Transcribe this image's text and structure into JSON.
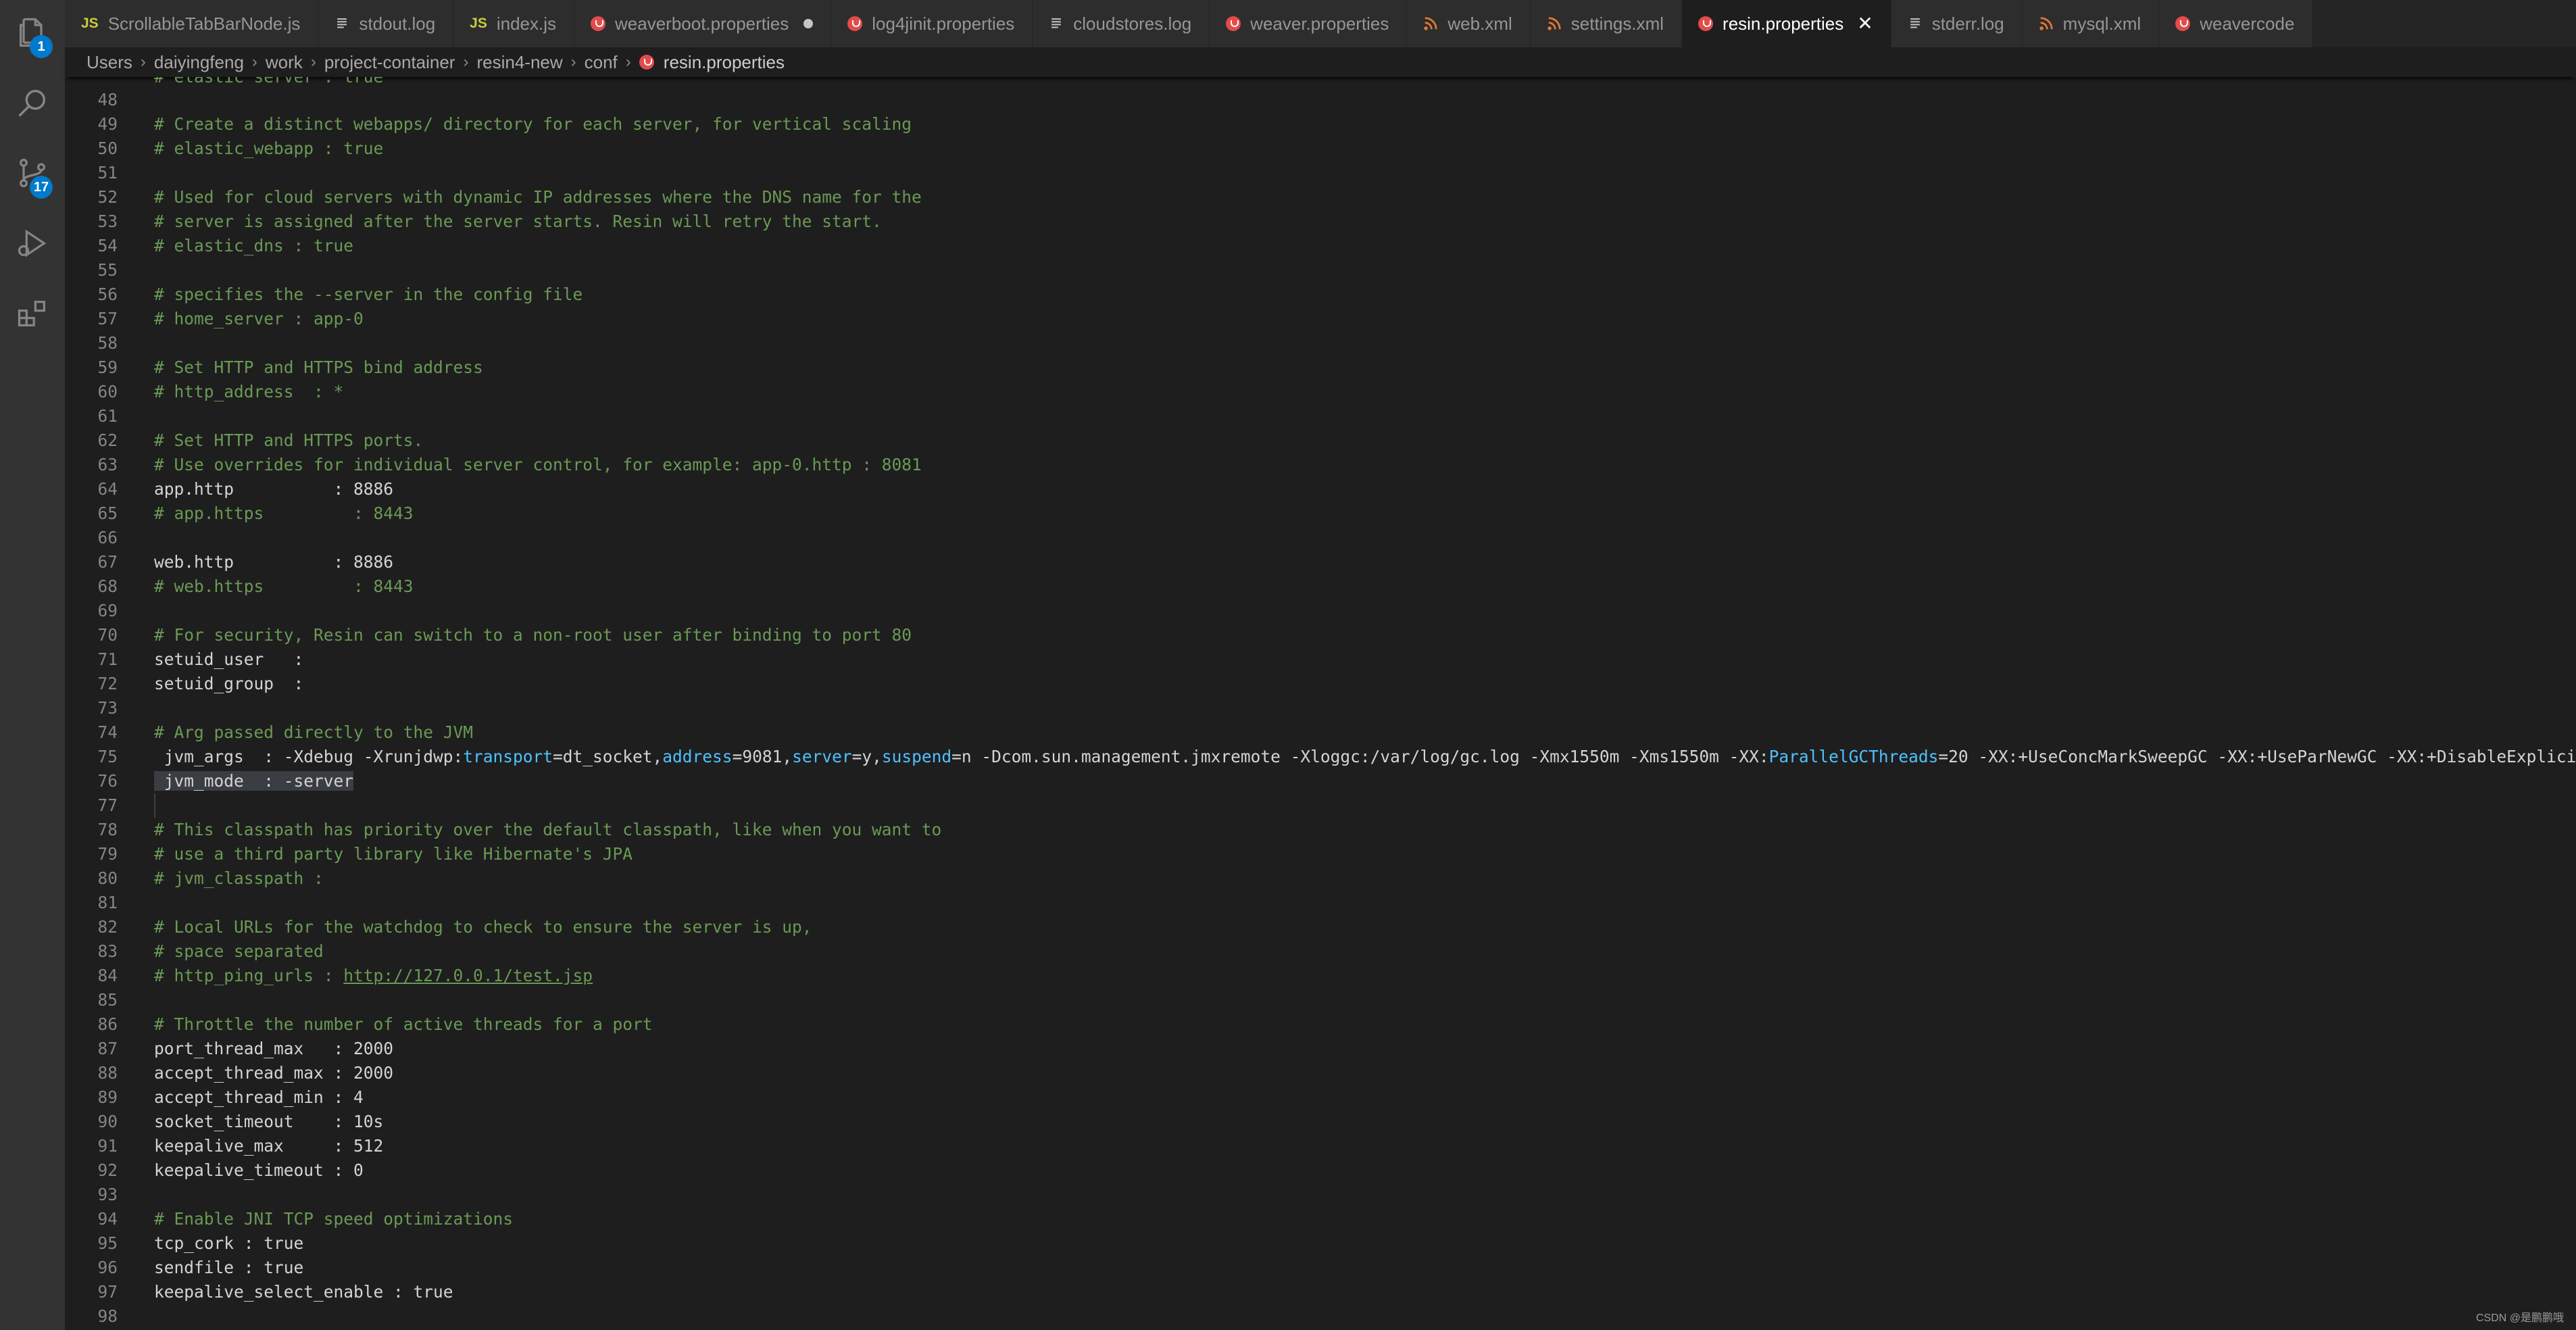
{
  "tabs": [
    {
      "label": "ScrollableTabBarNode.js",
      "icon": "js-file-icon",
      "modified": false,
      "active": false
    },
    {
      "label": "stdout.log",
      "icon": "text-file-icon",
      "modified": false,
      "active": false
    },
    {
      "label": "index.js",
      "icon": "js-file-icon",
      "modified": false,
      "active": false
    },
    {
      "label": "weaverboot.properties",
      "icon": "properties-file-icon",
      "modified": true,
      "active": false
    },
    {
      "label": "log4jinit.properties",
      "icon": "properties-file-icon",
      "modified": false,
      "active": false
    },
    {
      "label": "cloudstores.log",
      "icon": "text-file-icon",
      "modified": false,
      "active": false
    },
    {
      "label": "weaver.properties",
      "icon": "properties-file-icon",
      "modified": false,
      "active": false
    },
    {
      "label": "web.xml",
      "icon": "xml-file-icon",
      "modified": false,
      "active": false
    },
    {
      "label": "settings.xml",
      "icon": "xml-file-icon",
      "modified": false,
      "active": false
    },
    {
      "label": "resin.properties",
      "icon": "properties-file-icon",
      "modified": false,
      "active": true
    },
    {
      "label": "stderr.log",
      "icon": "text-file-icon",
      "modified": false,
      "active": false
    },
    {
      "label": "mysql.xml",
      "icon": "xml-file-icon",
      "modified": false,
      "active": false
    },
    {
      "label": "weavercode",
      "icon": "properties-file-icon",
      "modified": false,
      "active": false
    }
  ],
  "activity_bar": {
    "explorer_badge": "1",
    "scm_badge": "17"
  },
  "breadcrumb": [
    "Users",
    "daiyingfeng",
    "work",
    "project-container",
    "resin4-new",
    "conf"
  ],
  "breadcrumb_file": "resin.properties",
  "editor": {
    "partial_top_line": "# elastic_server : true",
    "lines": [
      {
        "n": "48",
        "t": ""
      },
      {
        "n": "49",
        "t": "# Create a distinct webapps/ directory for each server, for vertical scaling"
      },
      {
        "n": "50",
        "t": "# elastic_webapp : true"
      },
      {
        "n": "51",
        "t": ""
      },
      {
        "n": "52",
        "t": "# Used for cloud servers with dynamic IP addresses where the DNS name for the"
      },
      {
        "n": "53",
        "t": "# server is assigned after the server starts. Resin will retry the start."
      },
      {
        "n": "54",
        "t": "# elastic_dns : true"
      },
      {
        "n": "55",
        "t": ""
      },
      {
        "n": "56",
        "t": "# specifies the --server in the config file"
      },
      {
        "n": "57",
        "t": "# home_server : app-0"
      },
      {
        "n": "58",
        "t": ""
      },
      {
        "n": "59",
        "t": "# Set HTTP and HTTPS bind address"
      },
      {
        "n": "60",
        "t": "# http_address  : *"
      },
      {
        "n": "61",
        "t": ""
      },
      {
        "n": "62",
        "t": "# Set HTTP and HTTPS ports."
      },
      {
        "n": "63",
        "t": "# Use overrides for individual server control, for example: app-0.http : 8081"
      },
      {
        "n": "64",
        "t": "app.http          : 8886"
      },
      {
        "n": "65",
        "t": "# app.https         : 8443"
      },
      {
        "n": "66",
        "t": ""
      },
      {
        "n": "67",
        "t": "web.http          : 8886"
      },
      {
        "n": "68",
        "t": "# web.https         : 8443"
      },
      {
        "n": "69",
        "t": ""
      },
      {
        "n": "70",
        "t": "# For security, Resin can switch to a non-root user after binding to port 80"
      },
      {
        "n": "71",
        "t": "setuid_user   :"
      },
      {
        "n": "72",
        "t": "setuid_group  :"
      },
      {
        "n": "73",
        "t": ""
      },
      {
        "n": "74",
        "t": "# Arg passed directly to the JVM"
      },
      {
        "n": "75",
        "t": " jvm_args  : -Xdebug -Xrunjdwp:transport=dt_socket,address=9081,server=y,suspend=n -Dcom.sun.management.jmxremote -Xloggc:/var/log/gc.log -Xmx1550m -Xms1550m -XX:ParallelGCThreads=20 -XX:+UseConcMarkSweepGC -XX:+UseParNewGC -XX:+DisableExplicitGC"
      },
      {
        "n": "76",
        "t": " jvm_mode  : -server"
      },
      {
        "n": "77",
        "t": ""
      },
      {
        "n": "78",
        "t": "# This classpath has priority over the default classpath, like when you want to"
      },
      {
        "n": "79",
        "t": "# use a third party library like Hibernate's JPA"
      },
      {
        "n": "80",
        "t": "# jvm_classpath :"
      },
      {
        "n": "81",
        "t": ""
      },
      {
        "n": "82",
        "t": "# Local URLs for the watchdog to check to ensure the server is up,"
      },
      {
        "n": "83",
        "t": "# space separated"
      },
      {
        "n": "84",
        "t": "# http_ping_urls : http://127.0.0.1/test.jsp"
      },
      {
        "n": "85",
        "t": ""
      },
      {
        "n": "86",
        "t": "# Throttle the number of active threads for a port"
      },
      {
        "n": "87",
        "t": "port_thread_max   : 2000"
      },
      {
        "n": "88",
        "t": "accept_thread_max : 2000"
      },
      {
        "n": "89",
        "t": "accept_thread_min : 4"
      },
      {
        "n": "90",
        "t": "socket_timeout    : 10s"
      },
      {
        "n": "91",
        "t": "keepalive_max     : 512"
      },
      {
        "n": "92",
        "t": "keepalive_timeout : 0"
      },
      {
        "n": "93",
        "t": ""
      },
      {
        "n": "94",
        "t": "# Enable JNI TCP speed optimizations"
      },
      {
        "n": "95",
        "t": "tcp_cork : true"
      },
      {
        "n": "96",
        "t": "sendfile : true"
      },
      {
        "n": "97",
        "t": "keepalive_select_enable : true"
      },
      {
        "n": "98",
        "t": ""
      }
    ]
  },
  "watermark": "CSDN @是鹏鹏哦",
  "colors": {
    "comment": "#6a9955",
    "keyword": "#4fc1ff",
    "text": "#d4d4d4",
    "accent": "#007acc"
  }
}
